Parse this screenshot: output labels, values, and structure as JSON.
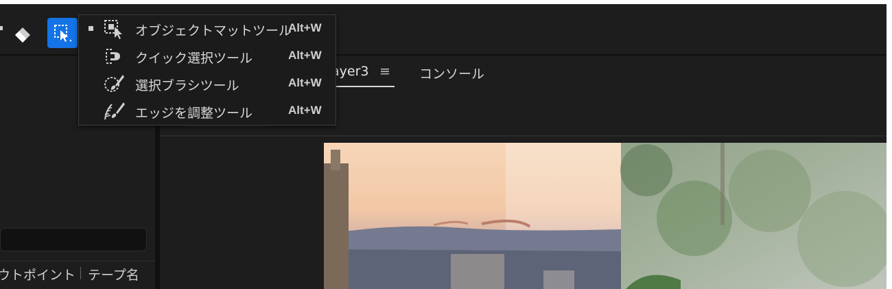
{
  "toolbar": {
    "active_tool": "roto-brush"
  },
  "popup_menu": {
    "items": [
      {
        "label": "オブジェクトマットツール",
        "shortcut": "Alt+W",
        "selected": true,
        "icon": "object-matte-icon"
      },
      {
        "label": "クイック選択ツール",
        "shortcut": "Alt+W",
        "selected": false,
        "icon": "quick-select-icon"
      },
      {
        "label": "選択ブラシツール",
        "shortcut": "Alt+W",
        "selected": false,
        "icon": "selection-brush-icon"
      },
      {
        "label": "エッジを調整ツール",
        "shortcut": "Alt+W",
        "selected": false,
        "icon": "refine-edge-icon"
      }
    ]
  },
  "tabs": {
    "layer": "ayer3",
    "menu_glyph": "≡",
    "console": "コンソール"
  },
  "project_panel": {
    "columns": {
      "in_point": "ウトポイント",
      "tape_name": "テープ名"
    }
  },
  "colors": {
    "accent": "#1473e6",
    "panel": "#1d1d1d",
    "divider": "#101010"
  }
}
